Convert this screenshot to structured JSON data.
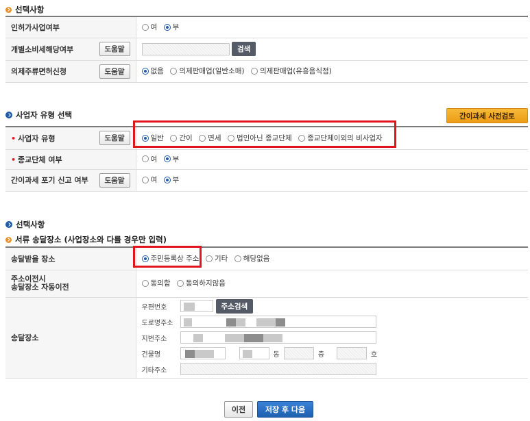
{
  "section1": {
    "title": "선택사항",
    "rows": {
      "licensed": {
        "label": "인허가사업여부",
        "options": [
          "여",
          "부"
        ],
        "selected": "부"
      },
      "excise": {
        "label": "개별소비세해당여부",
        "help": "도움말",
        "search": "검색"
      },
      "liquor": {
        "label": "의제주류면허신청",
        "help": "도움말",
        "options": [
          "없음",
          "의제판매업(일반소매)",
          "의제판매업(유흥음식점)"
        ],
        "selected": "없음"
      }
    }
  },
  "section2": {
    "title": "사업자 유형 선택",
    "precheck_button": "간이과세 사전검토",
    "rows": {
      "biz_type": {
        "label": "사업자 유형",
        "help": "도움말",
        "options": [
          "일반",
          "간이",
          "면세",
          "법인아닌 종교단체",
          "종교단체이외의 비사업자"
        ],
        "selected": "일반"
      },
      "religious": {
        "label": "종교단체 여부",
        "options": [
          "여",
          "부"
        ],
        "selected": "부"
      },
      "simple_waive": {
        "label": "간이과세 포기 신고 여부",
        "help": "도움말",
        "options": [
          "여",
          "부"
        ],
        "selected": "부"
      }
    }
  },
  "section3": {
    "title": "선택사항",
    "subtitle": "서류 송달장소 (사업장소와 다를 경우만 입력)",
    "rows": {
      "delivery_place": {
        "label": "송달받을 장소",
        "options": [
          "주민등록상 주소",
          "기타",
          "해당없음"
        ],
        "selected": "주민등록상 주소"
      },
      "auto_transfer": {
        "label_line1": "주소이전시",
        "label_line2": "송달장소 자동이전",
        "options": [
          "동의함",
          "동의하지않음"
        ]
      },
      "address": {
        "label": "송달장소",
        "postal_label": "우편번호",
        "postal_search": "주소검색",
        "road_label": "도로명주소",
        "lot_label": "지번주소",
        "building_label": "건물명",
        "dong_unit": "동",
        "floor_unit": "층",
        "ho_unit": "호",
        "other_label": "기타주소"
      }
    }
  },
  "footer": {
    "prev": "이전",
    "save_next": "저장 후 다음"
  }
}
